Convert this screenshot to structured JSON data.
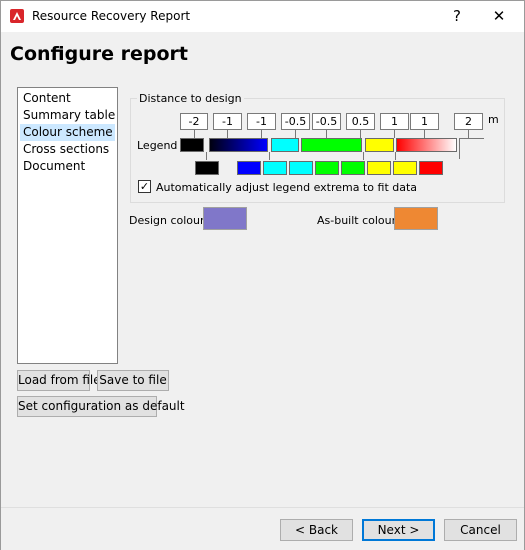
{
  "window": {
    "title": "Resource Recovery Report",
    "help": "?",
    "close": "✕"
  },
  "page": {
    "title": "Configure report"
  },
  "nav": {
    "items": [
      "Content",
      "Summary table",
      "Colour scheme",
      "Cross sections",
      "Document"
    ],
    "selected": "Colour scheme"
  },
  "buttons": {
    "load": "Load from file",
    "save": "Save to file",
    "set_default": "Set configuration as default",
    "back": "< Back",
    "next": "Next >",
    "cancel": "Cancel"
  },
  "colour_scheme": {
    "group_label": "Distance to design",
    "distances": [
      "-2",
      "-1",
      "-1",
      "-0.5",
      "-0.5",
      "0.5",
      "1",
      "1",
      "2"
    ],
    "unit": "m",
    "legend_label": "Legend",
    "legend_top_colors": [
      "#000000",
      "gradient-black-blue",
      "#00ffff",
      "#00ff00",
      "#ffff00",
      "gradient-red-white"
    ],
    "legend_bottom_colors": [
      "#000000",
      "#0000ff",
      "#00ffff",
      "#00ffff",
      "#00ff00",
      "#00ff00",
      "#ffff00",
      "#ffff00",
      "#ff0000"
    ],
    "auto_adjust": {
      "label": "Automatically adjust legend extrema to fit data",
      "checked": true
    },
    "design_colour": {
      "label": "Design colour",
      "color": "#8077c9"
    },
    "as_built_colour": {
      "label": "As-built colour",
      "color": "#ee8833"
    }
  },
  "colors": {
    "accent": "#0078d7",
    "selection": "#cce8ff",
    "app_icon": "#d9262b"
  }
}
